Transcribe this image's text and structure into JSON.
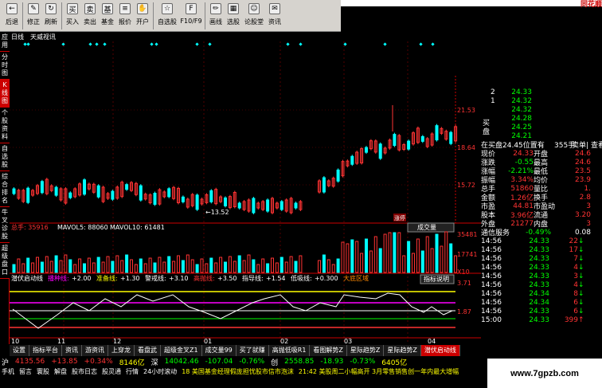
{
  "toolbar": {
    "buttons": [
      {
        "label": "后退",
        "icon": "back-icon"
      },
      {
        "label": "修正",
        "icon": "pencil-icon"
      },
      {
        "label": "刷新",
        "icon": "refresh-icon"
      },
      {
        "label": "买入",
        "icon": "buy-icon"
      },
      {
        "label": "卖出",
        "icon": "sell-icon"
      },
      {
        "label": "基金",
        "icon": "fund-icon"
      },
      {
        "label": "报价",
        "icon": "quote-icon"
      },
      {
        "label": "开户",
        "icon": "account-icon"
      },
      {
        "label": "自选股",
        "icon": "star-icon"
      },
      {
        "label": "F10/F9",
        "icon": "f10-icon"
      },
      {
        "label": "画线",
        "icon": "draw-icon"
      },
      {
        "label": "选股",
        "icon": "pick-icon"
      },
      {
        "label": "论股堂",
        "icon": "forum-icon"
      },
      {
        "label": "资讯",
        "icon": "news-icon"
      }
    ],
    "brand": "同花顺"
  },
  "left_tabs": [
    "应用",
    "分时图",
    "K线图",
    "个股资料",
    "自选股",
    "综合排名",
    "牛叉诊股",
    "超级盘口"
  ],
  "chart": {
    "period_label": "日线",
    "info_label": "天威视讯",
    "price_ticks": [
      "21.53",
      "18.64",
      "15.72"
    ],
    "low_annotation": "←13.52",
    "volume_bar": {
      "total": "总手: 35916",
      "mavol5": "MAVOL5: 88060",
      "mavol10": "MAVOL10: 61481",
      "button": "成交量",
      "ticks": [
        "35481",
        "17741",
        "X10"
      ]
    },
    "indicator_bar": {
      "name": "潜伏启动线",
      "items": [
        {
          "label": "播种线:",
          "value": "+2.00"
        },
        {
          "label": "准备线:",
          "value": "+1.30"
        },
        {
          "label": "警戒线:",
          "value": "+3.10"
        },
        {
          "label": "高抛线:",
          "value": "+3.50"
        },
        {
          "label": "指导线:",
          "value": "+1.54"
        },
        {
          "label": "低吸线:",
          "value": "+0.300"
        },
        {
          "label": "大底区域",
          "value": ""
        }
      ],
      "help": "指标说明",
      "ticks": [
        "3.71",
        "1.87"
      ]
    },
    "date_ticks": [
      "10",
      "11",
      "12",
      "01",
      "02",
      "03",
      "04"
    ],
    "marker": "涨停",
    "colors": {
      "up": "#ff3333",
      "down": "#00ffff",
      "yellow": "#ffff00",
      "magenta": "#ff00ff",
      "green": "#00ff00",
      "white": "#ffffff"
    }
  },
  "bottom_tabs": [
    "设置",
    "指标平台",
    "资讯",
    "游资讯",
    "上穿龙",
    "看盘武",
    "超级金叉Z1",
    "成交量99",
    "买了就赚",
    "高抛低吸R1",
    "看图解势Z",
    "星际趋势Z",
    "星际趋势Z",
    "潜伏启动线"
  ],
  "order_book": {
    "sell_rows": [
      {
        "level": "2",
        "price": "24.33",
        "vol": ""
      },
      {
        "level": "1",
        "price": "24.32",
        "vol": ""
      }
    ],
    "buy_label": "买盘",
    "buy_rows": [
      {
        "level": "",
        "price": "24.32",
        "vol": ""
      },
      {
        "level": "",
        "price": "24.28",
        "vol": ""
      },
      {
        "level": "",
        "price": "24.25",
        "vol": ""
      },
      {
        "level": "",
        "price": "24.21",
        "vol": ""
      }
    ],
    "info_line": "在买盘24.45位置有",
    "info_vol": "355手",
    "sell_single": "卖单|",
    "see_more": "查看"
  },
  "stats": [
    {
      "k": "现价",
      "v": "24.33",
      "k2": "开盘",
      "v2": "24.6"
    },
    {
      "k": "涨跌",
      "v": "-0.55",
      "k2": "最高",
      "v2": "24.6"
    },
    {
      "k": "涨幅",
      "v": "-2.21%",
      "k2": "最低",
      "v2": "23.5"
    },
    {
      "k": "振幅",
      "v": "3.34%",
      "k2": "均价",
      "v2": "23.9"
    },
    {
      "k": "总手",
      "v": "51860",
      "k2": "量比",
      "v2": "1."
    },
    {
      "k": "金额",
      "v": "1.26亿",
      "k2": "换手",
      "v2": "2.8"
    },
    {
      "k": "市盈",
      "v": "44.81",
      "k2": "市盈动",
      "v2": "3"
    },
    {
      "k": "股本",
      "v": "3.96亿",
      "k2": "流通",
      "v2": "3.20"
    },
    {
      "k": "外盘",
      "v": "21277",
      "k2": "内盘",
      "v2": "3"
    }
  ],
  "trades_header": {
    "label": "通信服务",
    "pct": "-0.49%",
    "lock": "0.08"
  },
  "trades": [
    {
      "time": "14:56",
      "price": "24.33",
      "vol": "22",
      "dir": "down"
    },
    {
      "time": "14:56",
      "price": "24.33",
      "vol": "17",
      "dir": "down"
    },
    {
      "time": "14:56",
      "price": "24.33",
      "vol": "7",
      "dir": "down"
    },
    {
      "time": "14:56",
      "price": "24.33",
      "vol": "4",
      "dir": "down"
    },
    {
      "time": "14:56",
      "price": "24.33",
      "vol": "3",
      "dir": "down"
    },
    {
      "time": "14:56",
      "price": "24.33",
      "vol": "4",
      "dir": "down"
    },
    {
      "time": "14:56",
      "price": "24.34",
      "vol": "8",
      "dir": "down"
    },
    {
      "time": "14:56",
      "price": "24.34",
      "vol": "6",
      "dir": "down"
    },
    {
      "time": "14:56",
      "price": "24.33",
      "vol": "6",
      "dir": "down"
    },
    {
      "time": "15:00",
      "price": "24.33",
      "vol": "399",
      "dir": "up"
    }
  ],
  "index_bar": [
    {
      "name": "沪",
      "val": "4135.56",
      "chg": "+13.85",
      "pct": "+0.34%",
      "amt": "8146亿",
      "dir": "up"
    },
    {
      "name": "深",
      "val": "14042.46",
      "chg": "-107.04",
      "pct": "-0.76%",
      "amt": "",
      "dir": "down"
    },
    {
      "name": "创",
      "val": "2558.85",
      "chg": "-18.93",
      "pct": "-0.73%",
      "amt": "6405亿",
      "dir": "down"
    }
  ],
  "news_tabs": [
    "手机",
    "留言",
    "寰股",
    "解盘",
    "股市日志",
    "股灵通",
    "行情",
    "24小时滚动"
  ],
  "news_ticker": "18 美国基金经理假庞担忧股市信市泡沫",
  "news_ticker2": "21:42 美股周二小幅高开  3月零售销售创一年内最大增幅",
  "watermark": "www.7gpzb.com"
}
